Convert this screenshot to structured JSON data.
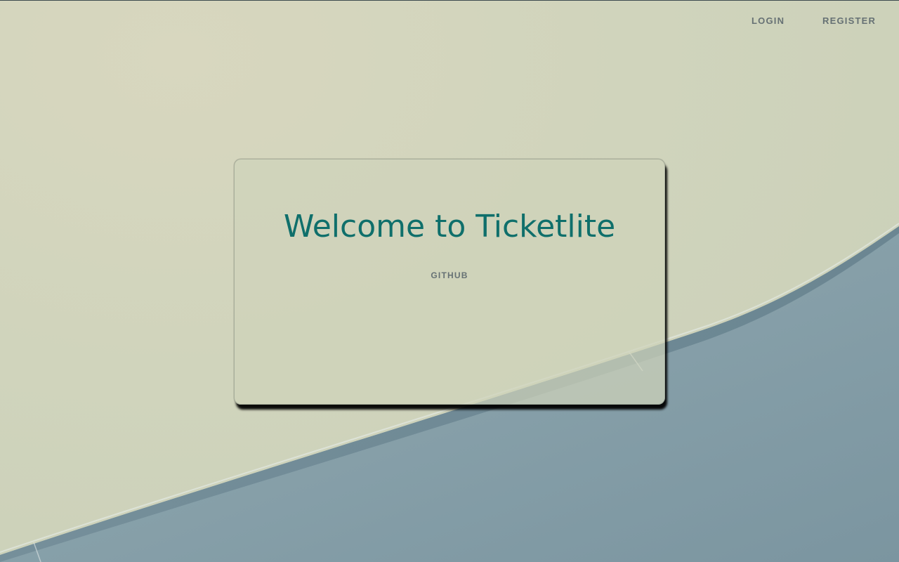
{
  "nav": {
    "login_label": "LOGIN",
    "register_label": "REGISTER"
  },
  "hero": {
    "title": "Welcome to Ticketlite",
    "github_label": "GITHUB"
  },
  "colors": {
    "title": "#0f6f6b",
    "nav_text": "#667174",
    "background_light": "#d0d4bc",
    "background_blue": "#7f99a3"
  }
}
